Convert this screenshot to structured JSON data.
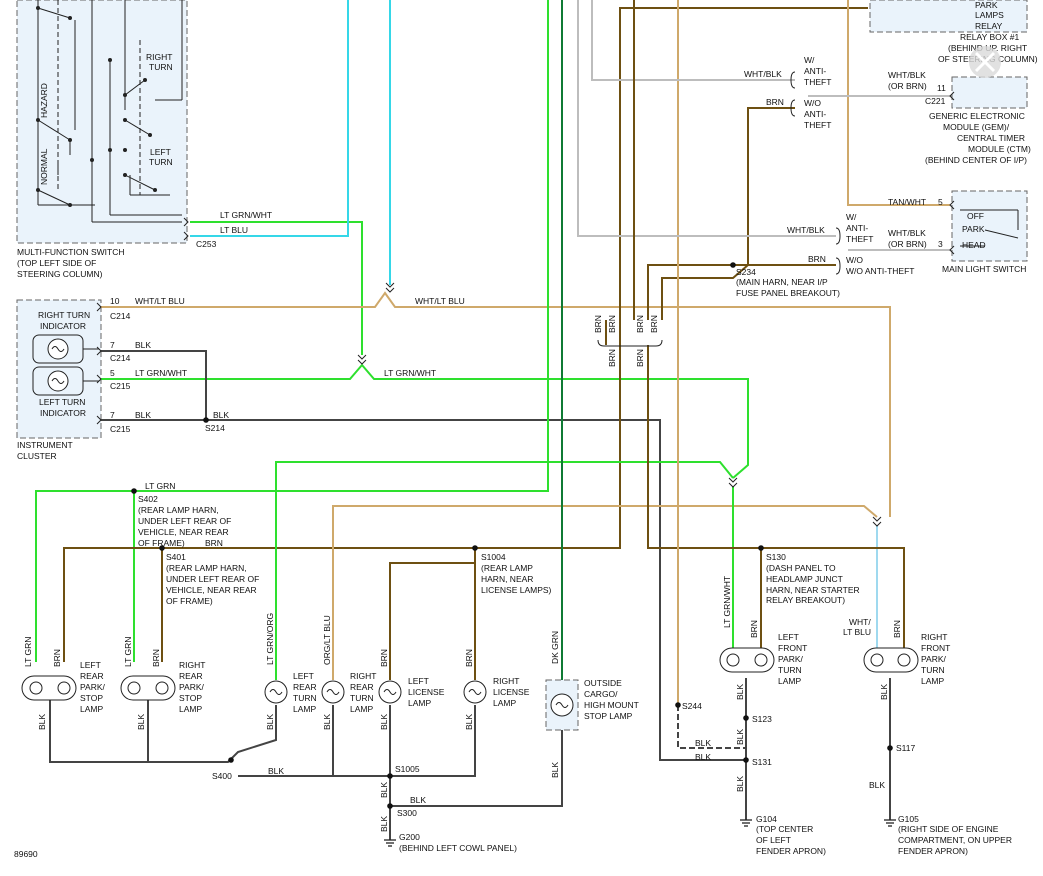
{
  "colors": {
    "brn": "#6e5012",
    "tan": "#cfa96b",
    "ltgrn": "#2ee02e",
    "ltblu": "#35d7e8",
    "dkgrn": "#0f7a34",
    "blk": "#444444",
    "wht": "#bdbdbd",
    "ltblu_light": "#9fd9ef"
  },
  "ui": {
    "close_icon": "x-icon",
    "figure_number": "89690"
  },
  "components": {
    "mfs": "MULTI-FUNCTION SWITCH",
    "mfs_loc1": "(TOP LEFT SIDE OF",
    "mfs_loc2": "STEERING COLUMN)",
    "hazard": "HAZARD",
    "normal": "NORMAL",
    "right_turn1": "RIGHT",
    "right_turn2": "TURN",
    "left_turn1": "LEFT",
    "left_turn2": "TURN",
    "c253": "C253",
    "ic1": "INSTRUMENT",
    "ic2": "CLUSTER",
    "rti1": "RIGHT TURN",
    "rti2": "INDICATOR",
    "lti1": "LEFT TURN",
    "lti2": "INDICATOR",
    "relay1": "PARK",
    "relay2": "LAMPS",
    "relay3": "RELAY",
    "relay4": "RELAY BOX #1",
    "relay5": "(BEHIND UP. RIGHT",
    "relay6": "OF STEERING COLUMN)",
    "gem1": "GENERIC ELECTRONIC",
    "gem2": "MODULE (GEM)/",
    "gem3": "CENTRAL TIMER",
    "gem4": "MODULE (CTM)",
    "gem5": "(BEHIND CENTER OF I/P)",
    "c221": "C221",
    "mls": "MAIN LIGHT SWITCH",
    "off": "OFF",
    "park": "PARK",
    "head": "HEAD",
    "lrpst1": "LEFT",
    "lrpst2": "REAR",
    "lrpst3": "PARK/",
    "lrpst4": "STOP",
    "lrpst5": "LAMP",
    "rrpst1": "RIGHT",
    "rrpst2": "REAR",
    "rrpst3": "PARK/",
    "rrpst4": "STOP",
    "rrpst5": "LAMP",
    "lrt1": "LEFT",
    "lrt2": "REAR",
    "lrt3": "TURN",
    "lrt4": "LAMP",
    "rrt1": "RIGHT",
    "rrt2": "REAR",
    "rrt3": "TURN",
    "rrt4": "LAMP",
    "ll1": "LEFT",
    "ll2": "LICENSE",
    "ll3": "LAMP",
    "rl1": "RIGHT",
    "rl2": "LICENSE",
    "rl3": "LAMP",
    "chm1": "OUTSIDE",
    "chm2": "CARGO/",
    "chm3": "HIGH MOUNT",
    "chm4": "STOP LAMP",
    "lf1": "LEFT",
    "lf2": "FRONT",
    "lf3": "PARK/",
    "lf4": "TURN",
    "lf5": "LAMP",
    "rf1": "RIGHT",
    "rf2": "FRONT",
    "rf3": "PARK/",
    "rf4": "TURN",
    "rf5": "LAMP"
  },
  "splices": {
    "s214": "S214",
    "s234": "S234",
    "s234_d1": "(MAIN HARN, NEAR I/P",
    "s234_d2": "FUSE PANEL BREAKOUT)",
    "s402": "S402",
    "s402_d1": "(REAR LAMP HARN,",
    "s402_d2": "UNDER LEFT REAR OF",
    "s402_d3": "VEHICLE, NEAR REAR",
    "s402_d4": "OF FRAME)",
    "s401": "S401",
    "s401_d1": "(REAR LAMP HARN,",
    "s401_d2": "UNDER LEFT REAR OF",
    "s401_d3": "VEHICLE, NEAR REAR",
    "s401_d4": "OF FRAME)",
    "s1004": "S1004",
    "s1004_d1": "(REAR LAMP",
    "s1004_d2": "HARN, NEAR",
    "s1004_d3": "LICENSE LAMPS)",
    "s130": "S130",
    "s130_d1": "(DASH PANEL TO",
    "s130_d2": "HEADLAMP JUNCT",
    "s130_d3": "HARN, NEAR STARTER",
    "s130_d4": "RELAY BREAKOUT)",
    "s400": "S400",
    "s1005": "S1005",
    "s300": "S300",
    "s244": "S244",
    "s123": "S123",
    "s131": "S131",
    "s117": "S117",
    "g200": "G200",
    "g200_d": "(BEHIND LEFT COWL PANEL)",
    "g104": "G104",
    "g104_d1": "(TOP CENTER",
    "g104_d2": "OF LEFT",
    "g104_d3": "FENDER APRON)",
    "g105": "G105",
    "g105_d1": "(RIGHT SIDE OF ENGINE",
    "g105_d2": "COMPARTMENT, ON UPPER",
    "g105_d3": "FENDER APRON)"
  },
  "wires": {
    "lt_grn_wht": "LT GRN/WHT",
    "lt_blu": "LT BLU",
    "wht_lt_blu": "WHT/LT BLU",
    "blk": "BLK",
    "lt_grn": "LT GRN",
    "brn": "BRN",
    "lt_grn_org": "LT GRN/ORG",
    "org_lt_blu": "ORG/LT BLU",
    "dk_grn": "DK GRN",
    "wht_blk": "WHT/BLK",
    "wht_blk_or_brn": "(OR BRN)",
    "tan_wht": "TAN/WHT",
    "wht_lt_blu_2a": "WHT/",
    "wht_lt_blu_2b": "LT BLU",
    "w_anti": "W/",
    "anti": "ANTI-",
    "theft": "THEFT",
    "wo": "W/O",
    "wo_anti_theft": "W/O ANTI-THEFT",
    "w_anti_theft_1": "W/",
    "pin10": "10",
    "pin7a": "7",
    "pin5": "5",
    "pin7b": "7",
    "pin11": "11",
    "pin3": "3",
    "pin5b": "5",
    "c214a": "C214",
    "c214b": "C214",
    "c215a": "C215",
    "c215b": "C215"
  }
}
